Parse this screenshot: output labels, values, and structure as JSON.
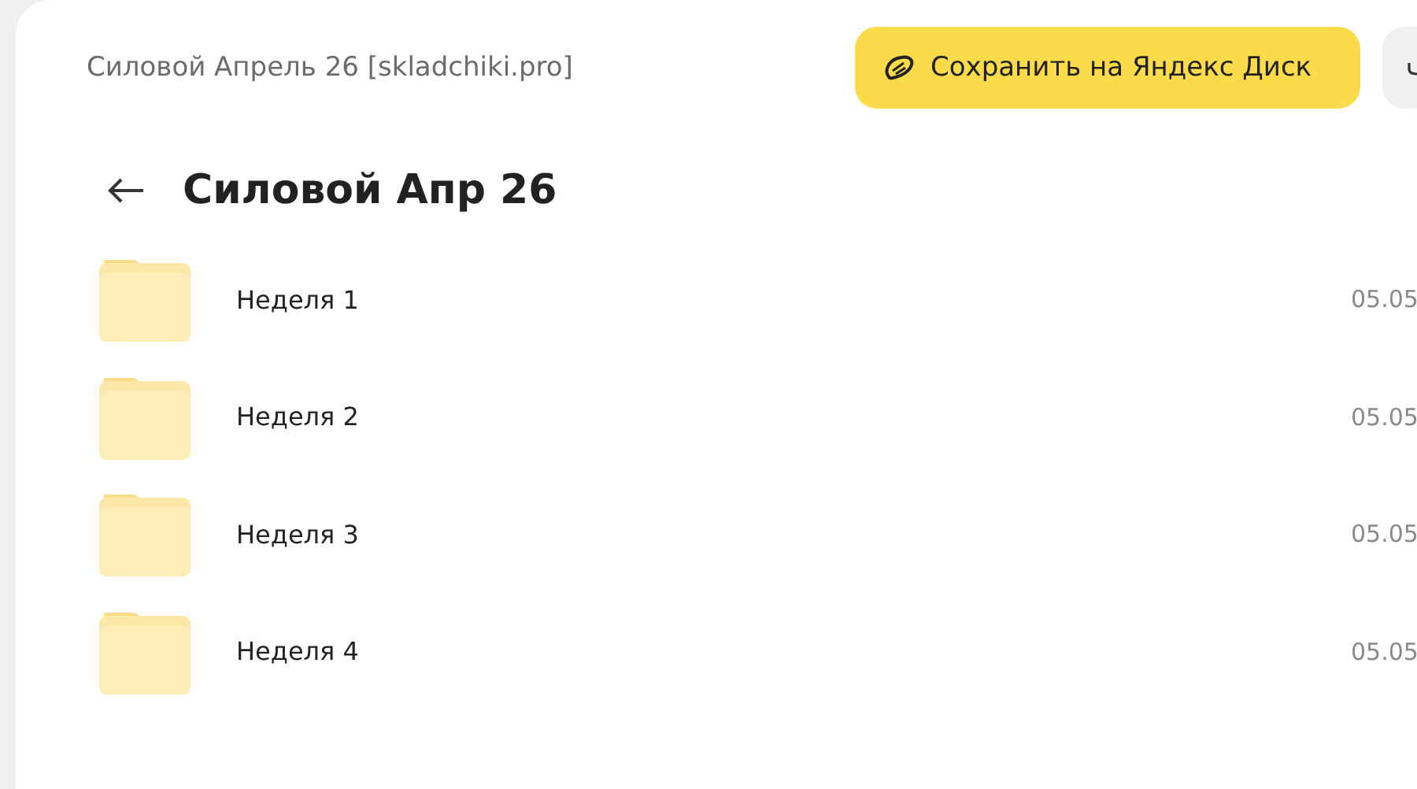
{
  "header": {
    "title": "Силовой Апрель 26 [skladchiki.pro]",
    "save_button": "Сохранить на Яндекс Диск"
  },
  "folder": {
    "title": "Силовой Апр 26"
  },
  "items": [
    {
      "name": "Неделя 1",
      "date": "05.05"
    },
    {
      "name": "Неделя 2",
      "date": "05.05"
    },
    {
      "name": "Неделя 3",
      "date": "05.05"
    },
    {
      "name": "Неделя 4",
      "date": "05.05"
    }
  ]
}
